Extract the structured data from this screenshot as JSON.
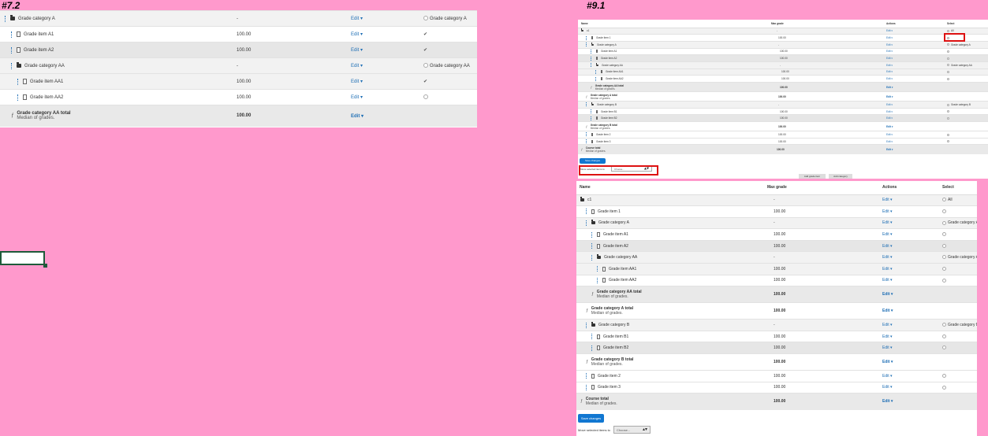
{
  "labels": {
    "left": "#7.2",
    "right": "#9.1"
  },
  "panel_a": {
    "rows": [
      {
        "depth": 0,
        "kind": "cat",
        "name": "Grade category A",
        "max": "-",
        "edit": "Edit",
        "sel": "radio",
        "sel_label": "Grade category A",
        "style": "odd"
      },
      {
        "depth": 1,
        "kind": "item",
        "name": "Grade item A1",
        "max": "100.00",
        "edit": "Edit",
        "sel": "check",
        "sel_label": "",
        "style": "even"
      },
      {
        "depth": 1,
        "kind": "item",
        "name": "Grade item A2",
        "max": "100.00",
        "edit": "Edit",
        "sel": "check",
        "sel_label": "",
        "style": "hl"
      },
      {
        "depth": 1,
        "kind": "cat",
        "name": "Grade category AA",
        "max": "-",
        "edit": "Edit",
        "sel": "radio",
        "sel_label": "Grade category AA",
        "style": "odd"
      },
      {
        "depth": 2,
        "kind": "item",
        "name": "Grade item AA1",
        "max": "100.00",
        "edit": "Edit",
        "sel": "check",
        "sel_label": "",
        "style": "odd"
      },
      {
        "depth": 2,
        "kind": "item",
        "name": "Grade item AA2",
        "max": "100.00",
        "edit": "Edit",
        "sel": "empty",
        "sel_label": "",
        "style": "even"
      },
      {
        "depth": 1,
        "kind": "total",
        "name": "Grade category AA total",
        "sub": "Median of grades.",
        "max": "100.00",
        "edit": "Edit",
        "sel": "none",
        "sel_label": "",
        "style": "total"
      }
    ]
  },
  "panel_b": {
    "headers": {
      "name": "Name",
      "max": "Max grade",
      "actions": "Actions",
      "select": "Select"
    },
    "save_label": "Save changes",
    "move_label": "Move selected items to",
    "move_value": "Choose...",
    "add_item": "Add grade item",
    "add_cat": "Add category",
    "rows": [
      {
        "depth": 0,
        "kind": "cat",
        "name": "c1",
        "max": "-",
        "edit": "Edit",
        "sel": "radio",
        "sel_label": "All",
        "style": "odd",
        "nodrag": true
      },
      {
        "depth": 1,
        "kind": "item",
        "name": "Grade item 1",
        "max": "100.00",
        "edit": "Edit",
        "sel": "radio",
        "sel_label": "",
        "style": "even"
      },
      {
        "depth": 1,
        "kind": "cat",
        "name": "Grade category A",
        "max": "-",
        "edit": "Edit",
        "sel": "radio",
        "sel_label": "Grade category A",
        "style": "odd"
      },
      {
        "depth": 2,
        "kind": "item",
        "name": "Grade item A1",
        "max": "100.00",
        "edit": "Edit",
        "sel": "radio",
        "sel_label": "",
        "style": "even"
      },
      {
        "depth": 2,
        "kind": "item",
        "name": "Grade item A2",
        "max": "100.00",
        "edit": "Edit",
        "sel": "radio",
        "sel_label": "",
        "style": "hl"
      },
      {
        "depth": 2,
        "kind": "cat",
        "name": "Grade category AA",
        "max": "-",
        "edit": "Edit",
        "sel": "radio",
        "sel_label": "Grade category AA",
        "style": "odd"
      },
      {
        "depth": 3,
        "kind": "item",
        "name": "Grade item AA1",
        "max": "100.00",
        "edit": "Edit",
        "sel": "radio",
        "sel_label": "",
        "style": "odd"
      },
      {
        "depth": 3,
        "kind": "item",
        "name": "Grade item AA2",
        "max": "100.00",
        "edit": "Edit",
        "sel": "radio",
        "sel_label": "",
        "style": "even"
      },
      {
        "depth": 2,
        "kind": "total",
        "name": "Grade category AA total",
        "sub": "Median of grades.",
        "max": "100.00",
        "edit": "Edit",
        "sel": "none",
        "sel_label": "",
        "style": "total"
      },
      {
        "depth": 1,
        "kind": "total",
        "name": "Grade category A total",
        "sub": "Median of grades.",
        "max": "100.00",
        "edit": "Edit",
        "sel": "none",
        "sel_label": "",
        "style": "even"
      },
      {
        "depth": 1,
        "kind": "cat",
        "name": "Grade category B",
        "max": "-",
        "edit": "Edit",
        "sel": "radio",
        "sel_label": "Grade category B",
        "style": "odd"
      },
      {
        "depth": 2,
        "kind": "item",
        "name": "Grade item B1",
        "max": "100.00",
        "edit": "Edit",
        "sel": "radio",
        "sel_label": "",
        "style": "even"
      },
      {
        "depth": 2,
        "kind": "item",
        "name": "Grade item B2",
        "max": "100.00",
        "edit": "Edit",
        "sel": "radio",
        "sel_label": "",
        "style": "hl"
      },
      {
        "depth": 1,
        "kind": "total",
        "name": "Grade category B total",
        "sub": "Median of grades.",
        "max": "100.00",
        "edit": "Edit",
        "sel": "none",
        "sel_label": "",
        "style": "even"
      },
      {
        "depth": 1,
        "kind": "item",
        "name": "Grade item 2",
        "max": "100.00",
        "edit": "Edit",
        "sel": "radio",
        "sel_label": "",
        "style": "even"
      },
      {
        "depth": 1,
        "kind": "item",
        "name": "Grade item 3",
        "max": "100.00",
        "edit": "Edit",
        "sel": "radio",
        "sel_label": "",
        "style": "even"
      },
      {
        "depth": 0,
        "kind": "total",
        "name": "Course total",
        "sub": "Median of grades.",
        "max": "100.00",
        "edit": "Edit",
        "sel": "none",
        "sel_label": "",
        "style": "total"
      }
    ]
  }
}
